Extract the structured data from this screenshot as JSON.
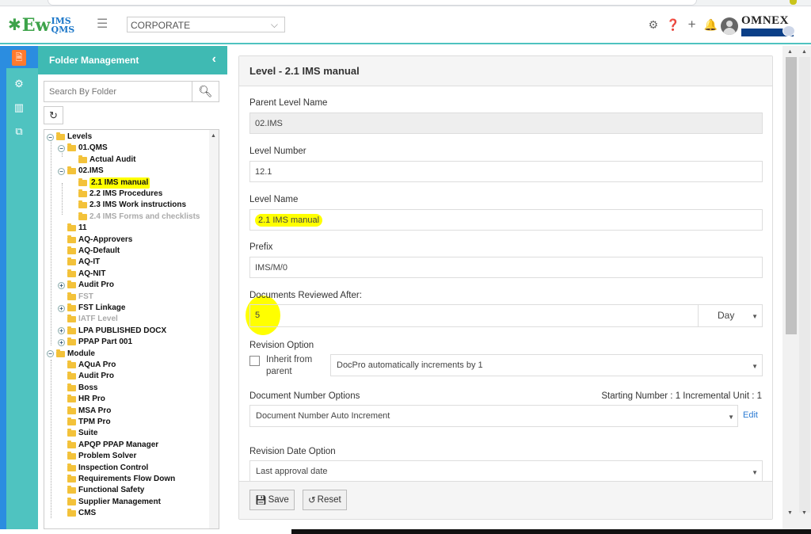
{
  "header": {
    "logo_main": "Ew",
    "logo_sup": "IMS",
    "logo_sub": "QMS",
    "company": "CORPORATE",
    "brand": "OMNEX"
  },
  "panel": {
    "title": "Folder Management",
    "search_placeholder": "Search By Folder"
  },
  "tree": [
    {
      "label": "Levels",
      "toggle": "−"
    },
    {
      "label": "01.QMS",
      "toggle": "−"
    },
    {
      "label": "Actual Audit"
    },
    {
      "label": "02.IMS",
      "toggle": "−"
    },
    {
      "label": "2.1 IMS manual",
      "highlighted": true
    },
    {
      "label": "2.2 IMS Procedures"
    },
    {
      "label": "2.3 IMS Work instructions"
    },
    {
      "label": "2.4 IMS Forms and checklists",
      "dim": true
    },
    {
      "label": "11"
    },
    {
      "label": "AQ-Approvers"
    },
    {
      "label": "AQ-Default"
    },
    {
      "label": "AQ-IT"
    },
    {
      "label": "AQ-NIT"
    },
    {
      "label": "Audit Pro",
      "toggle": "+"
    },
    {
      "label": "FST",
      "dim": true
    },
    {
      "label": "FST Linkage",
      "toggle": "+"
    },
    {
      "label": "IATF Level",
      "dim": true
    },
    {
      "label": "LPA PUBLISHED DOCX",
      "toggle": "+"
    },
    {
      "label": "PPAP Part 001",
      "toggle": "+"
    },
    {
      "label": "Module",
      "toggle": "−"
    },
    {
      "label": "AQuA Pro"
    },
    {
      "label": "Audit Pro"
    },
    {
      "label": "Boss"
    },
    {
      "label": "HR Pro"
    },
    {
      "label": "MSA Pro"
    },
    {
      "label": "TPM Pro"
    },
    {
      "label": "Suite"
    },
    {
      "label": "APQP PPAP Manager"
    },
    {
      "label": "Problem Solver"
    },
    {
      "label": "Inspection Control"
    },
    {
      "label": "Requirements Flow Down"
    },
    {
      "label": "Functional Safety"
    },
    {
      "label": "Supplier Management"
    },
    {
      "label": "CMS"
    }
  ],
  "form": {
    "title": "Level - 2.1 IMS manual",
    "parent_label": "Parent Level Name",
    "parent_value": "02.IMS",
    "number_label": "Level Number",
    "number_value": "12.1",
    "name_label": "Level Name",
    "name_value": "2.1 IMS manual",
    "prefix_label": "Prefix",
    "prefix_value": "IMS/M/0",
    "reviewed_label": "Documents Reviewed After:",
    "reviewed_value": "5",
    "reviewed_unit": "Day",
    "revision_label": "Revision Option",
    "inherit_label": "Inherit from parent",
    "revision_value": "DocPro automatically increments by 1",
    "docnum_label": "Document Number Options",
    "start_info": "Starting Number : 1 Incremental Unit : 1",
    "docnum_value": "Document Number Auto Increment",
    "edit_label": "Edit",
    "revdate_label": "Revision Date Option",
    "revdate_value": "Last approval date",
    "save_label": "Save",
    "reset_label": "Reset"
  }
}
